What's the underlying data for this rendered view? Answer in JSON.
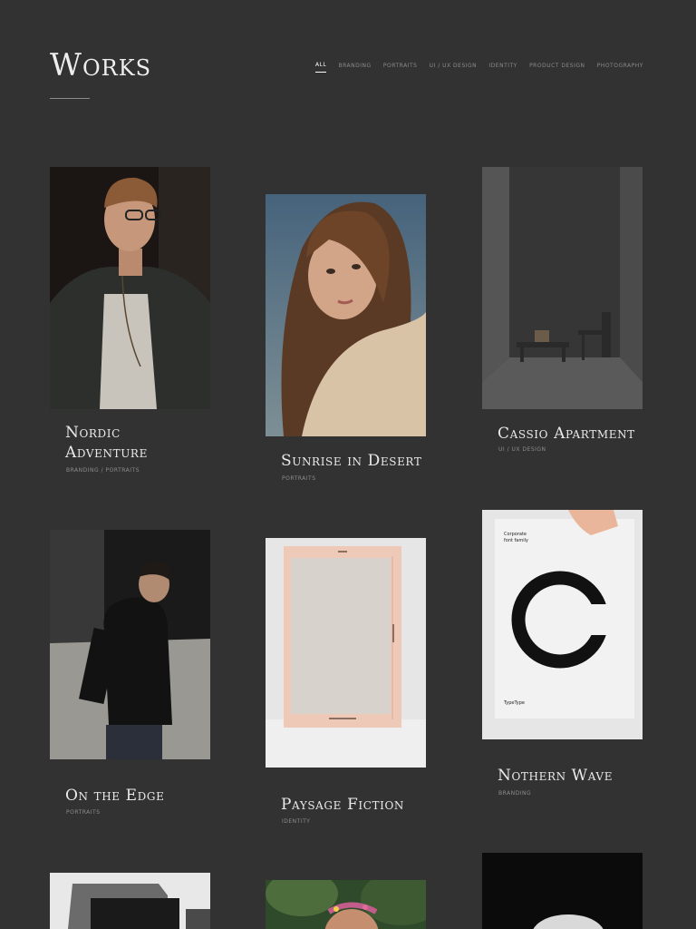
{
  "header": {
    "title": "Works"
  },
  "filters": [
    {
      "label": "All",
      "active": true
    },
    {
      "label": "Branding",
      "active": false
    },
    {
      "label": "Portraits",
      "active": false
    },
    {
      "label": "UI / UX Design",
      "active": false
    },
    {
      "label": "Identity",
      "active": false
    },
    {
      "label": "Product Design",
      "active": false
    },
    {
      "label": "Photography",
      "active": false
    }
  ],
  "works": [
    {
      "title_line1": "Nordic",
      "title_line2": "Adventure",
      "category": "Branding / Portraits",
      "image": "portrait-man-glasses"
    },
    {
      "title": "Sunrise in Desert",
      "category": "Portraits",
      "image": "portrait-woman-desert"
    },
    {
      "title": "Cassio Apartment",
      "category": "UI / UX Design",
      "image": "minimal-interior"
    },
    {
      "title": "On the Edge",
      "category": "Portraits",
      "image": "man-walking-black"
    },
    {
      "title": "Paysage Fiction",
      "category": "Identity",
      "image": "notebook-mockup"
    },
    {
      "title": "Nothern Wave",
      "category": "Branding",
      "image": "typeface-poster"
    }
  ],
  "poster": {
    "line1": "Corporate",
    "line2": "font family",
    "letter": "C",
    "footer": "TypeType"
  }
}
